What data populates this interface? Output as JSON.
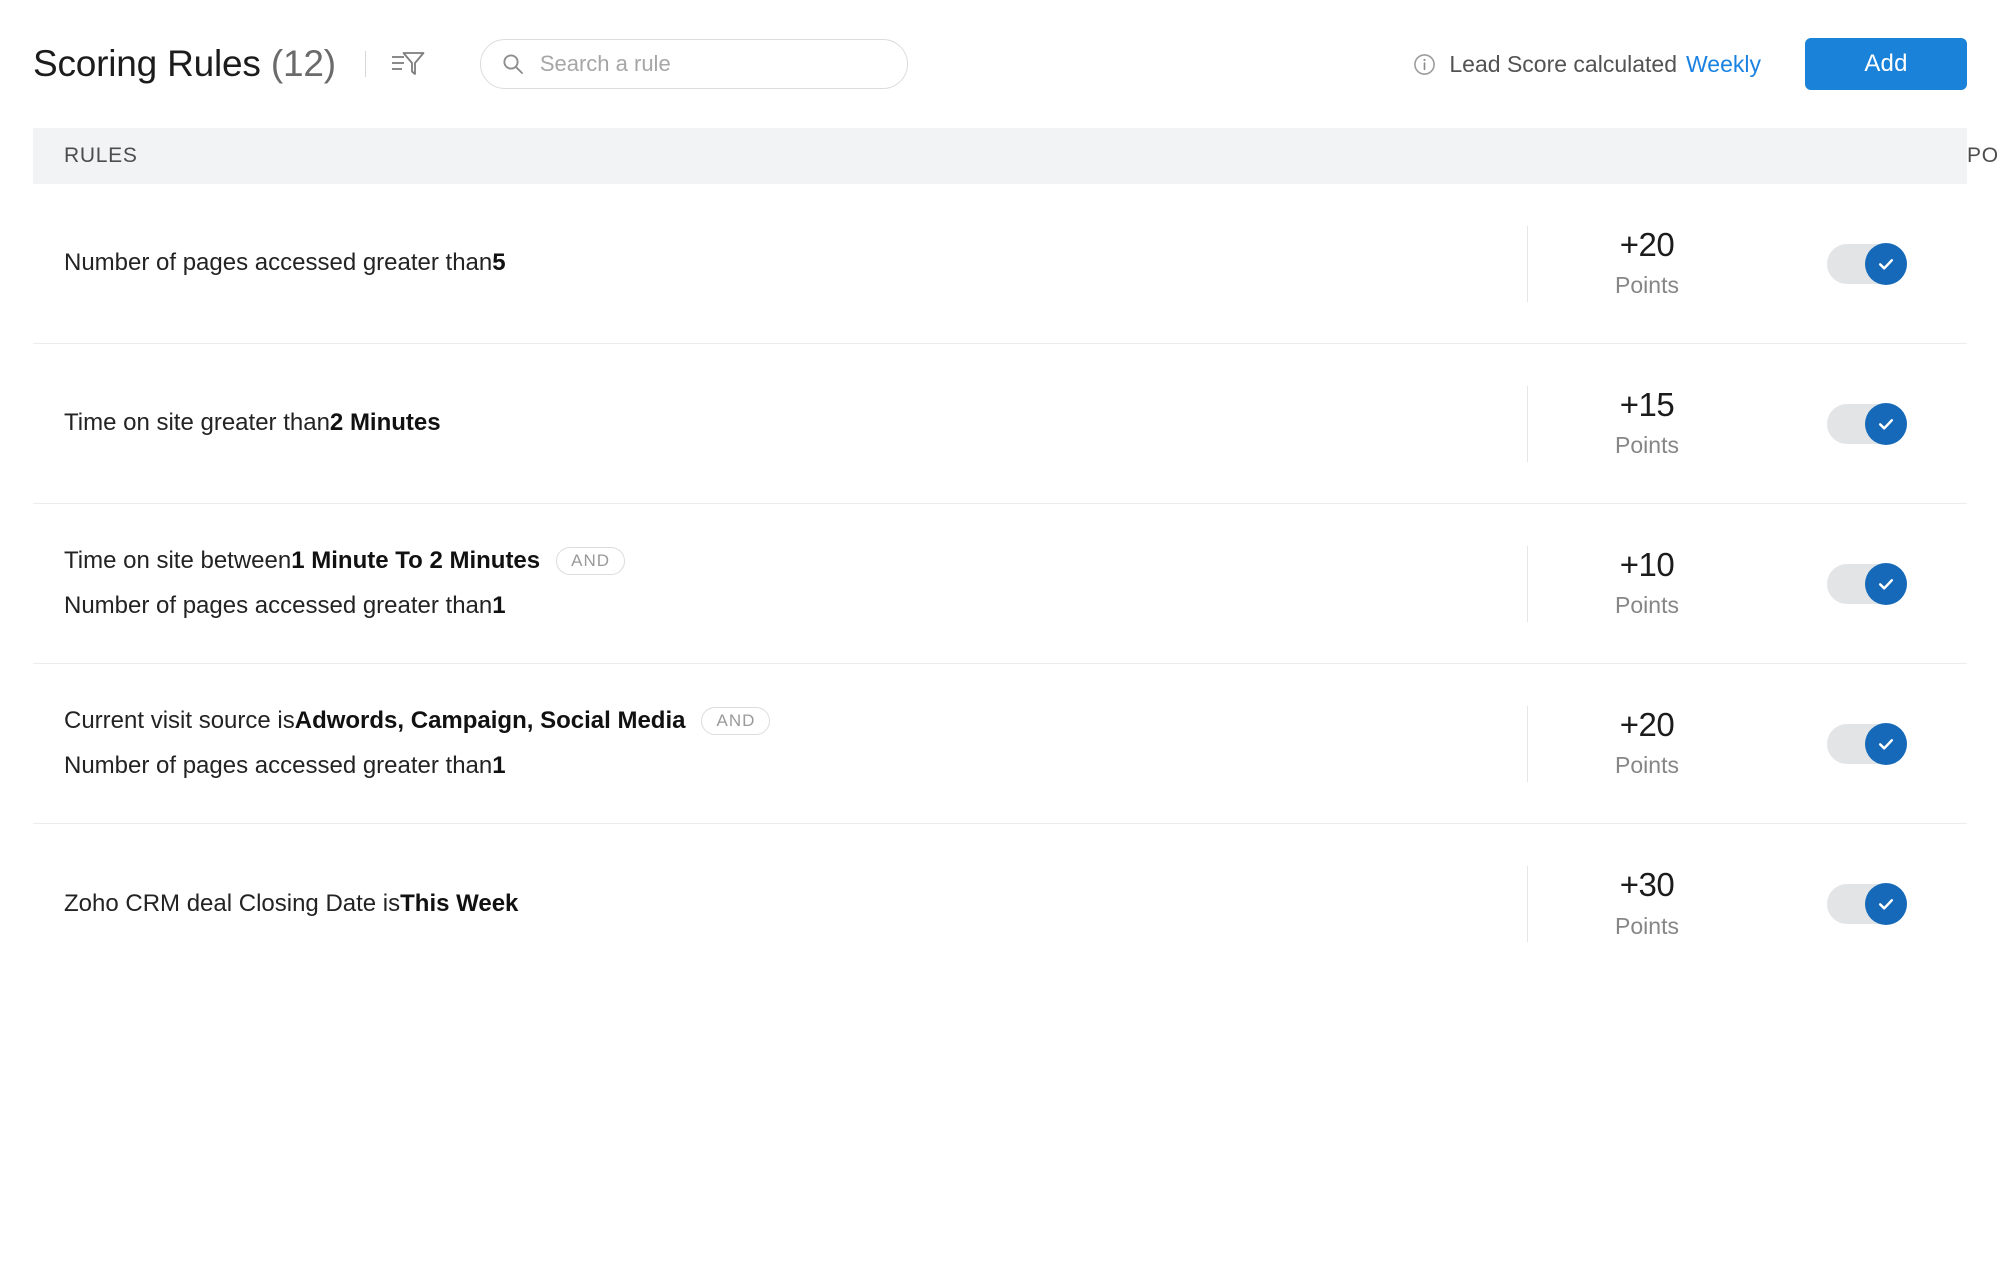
{
  "header": {
    "title": "Scoring Rules",
    "count": "(12)",
    "filter_icon": "filter-icon",
    "search": {
      "placeholder": "Search a rule",
      "value": "",
      "icon": "search-icon"
    },
    "calc_note": {
      "info_icon": "info-circle-icon",
      "text": "Lead Score calculated",
      "frequency": "Weekly"
    },
    "add_label": "Add"
  },
  "table": {
    "columns": [
      "RULES",
      "POINTS"
    ],
    "rows": [
      {
        "lines": [
          {
            "prefix": "Number of pages accessed greater than ",
            "value": "5",
            "badge": ""
          }
        ],
        "points": "+20",
        "points_label": "Points",
        "enabled": true
      },
      {
        "lines": [
          {
            "prefix": "Time on site greater than ",
            "value": "2 Minutes",
            "badge": ""
          }
        ],
        "points": "+15",
        "points_label": "Points",
        "enabled": true
      },
      {
        "lines": [
          {
            "prefix": "Time on site between ",
            "value": "1 Minute To 2 Minutes",
            "badge": "AND"
          },
          {
            "prefix": "Number of pages accessed greater than ",
            "value": "1",
            "badge": ""
          }
        ],
        "points": "+10",
        "points_label": "Points",
        "enabled": true
      },
      {
        "lines": [
          {
            "prefix": "Current visit source is ",
            "value": "Adwords, Campaign, Social Media",
            "badge": "AND"
          },
          {
            "prefix": "Number of pages accessed greater than ",
            "value": "1",
            "badge": ""
          }
        ],
        "points": "+20",
        "points_label": "Points",
        "enabled": true
      },
      {
        "lines": [
          {
            "prefix": "Zoho CRM deal Closing Date is ",
            "value": "This Week",
            "badge": ""
          }
        ],
        "points": "+30",
        "points_label": "Points",
        "enabled": true
      }
    ]
  },
  "colors": {
    "accent_blue": "#1a82d8",
    "link_blue": "#1a82e2",
    "toggle_blue": "#1669b8",
    "toggle_track": "#e2e4e6",
    "table_head_bg": "#f1f3f5",
    "row_divider": "#ececec",
    "text_primary": "#232323",
    "text_muted": "#868686"
  }
}
